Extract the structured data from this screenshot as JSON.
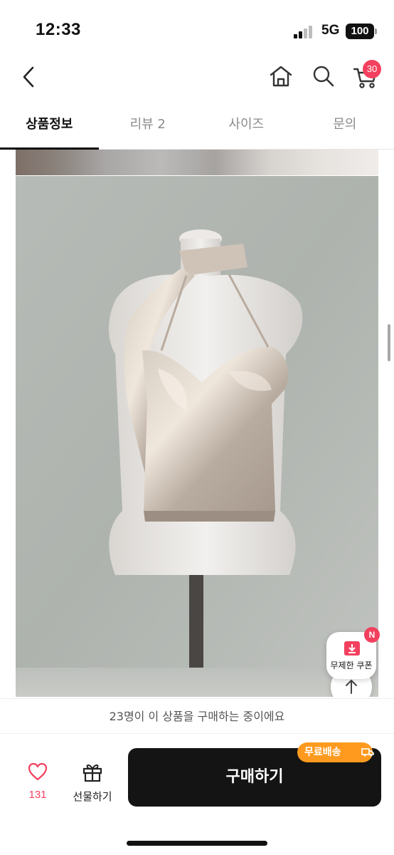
{
  "status_bar": {
    "time": "12:33",
    "network": "5G",
    "battery": "100"
  },
  "header": {
    "back_icon": "chevron-left-icon",
    "home_icon": "home-icon",
    "search_icon": "search-icon",
    "cart_icon": "cart-icon",
    "cart_count": "30",
    "accent_color": "#f3405e"
  },
  "tabs": [
    {
      "label": "상품정보",
      "active": true
    },
    {
      "label": "리뷰 2",
      "active": false
    },
    {
      "label": "사이즈",
      "active": false
    },
    {
      "label": "문의",
      "active": false
    }
  ],
  "floating": {
    "up_icon": "arrow-up-icon",
    "down_icon": "arrow-down-icon",
    "coupon_label": "무제한 쿠폰",
    "coupon_badge": "N"
  },
  "notice": {
    "text": "23명이 이 상품을 구매하는 중이에요"
  },
  "bottom_bar": {
    "like_count": "131",
    "gift_label": "선물하기",
    "buy_label": "구매하기",
    "shipping_badge": "무료배송",
    "buy_color": "#141414",
    "badge_color": "#ff9a1f"
  }
}
